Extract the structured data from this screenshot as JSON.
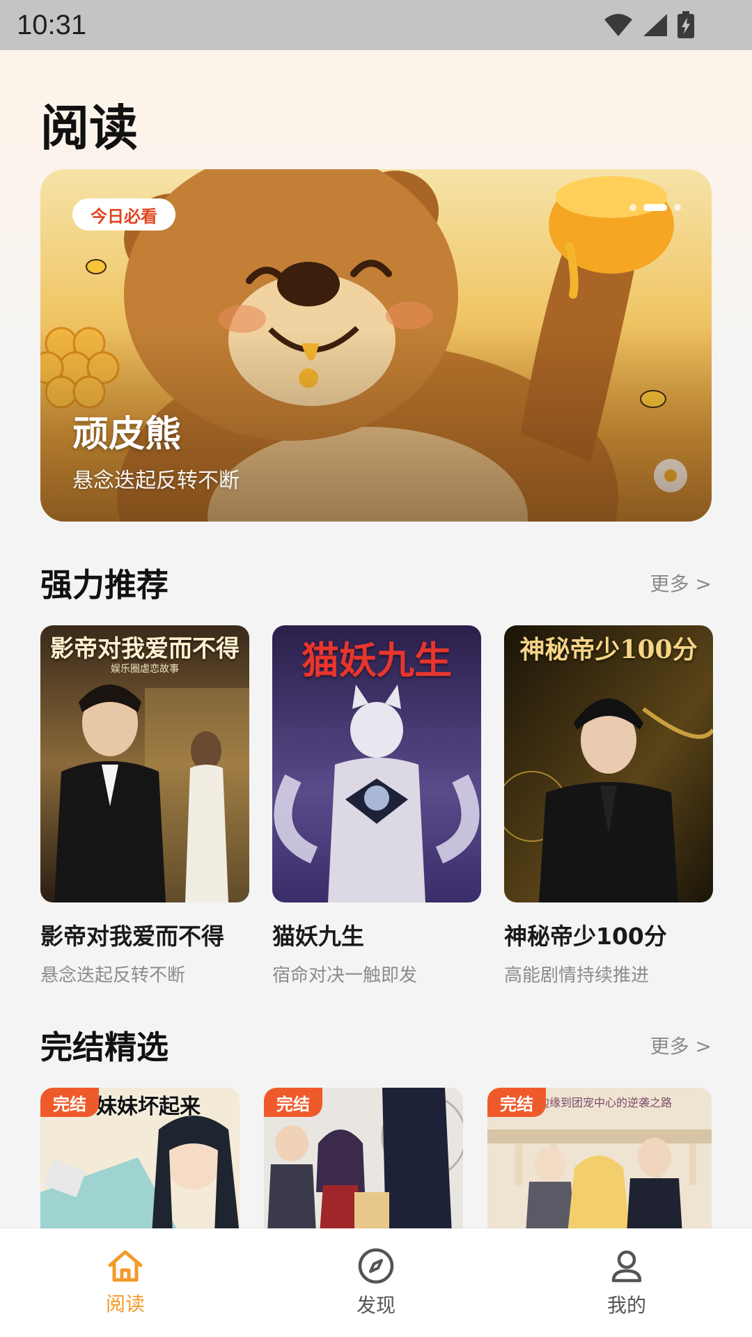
{
  "status_bar": {
    "time": "10:31"
  },
  "page": {
    "title": "阅读"
  },
  "hero": {
    "badge": "今日必看",
    "title": "顽皮熊",
    "subtitle": "悬念迭起反转不断",
    "dots": 3,
    "active_dot": 1
  },
  "recommend": {
    "title": "强力推荐",
    "more": "更多 >",
    "books": [
      {
        "title": "影帝对我爱而不得",
        "subtitle": "悬念迭起反转不断",
        "cover_text": "影帝对我爱而不得",
        "cover_tag": "娱乐圈虐恋故事"
      },
      {
        "title": "猫妖九生",
        "subtitle": "宿命对决一触即发",
        "cover_text": "猫妖九生"
      },
      {
        "title": "神秘帝少100分",
        "subtitle": "高能剧情持续推进",
        "cover_text": "神秘帝少100分"
      }
    ]
  },
  "finished": {
    "title": "完结精选",
    "more": "更多 >",
    "badge": "完结",
    "books": [
      {
        "cover_text": "妹妹坏起来"
      },
      {
        "cover_text": ""
      },
      {
        "cover_text": "从边缘到团宠中心的逆袭之路"
      }
    ]
  },
  "nav": {
    "items": [
      {
        "label": "阅读",
        "icon": "home-icon",
        "active": true
      },
      {
        "label": "发现",
        "icon": "compass-icon",
        "active": false
      },
      {
        "label": "我的",
        "icon": "user-icon",
        "active": false
      }
    ],
    "active_color": "#f39a2a"
  },
  "colors": {
    "accent": "#f39a2a",
    "badge_red": "#ef5a2b",
    "hero_badge_text": "#e0451f"
  }
}
